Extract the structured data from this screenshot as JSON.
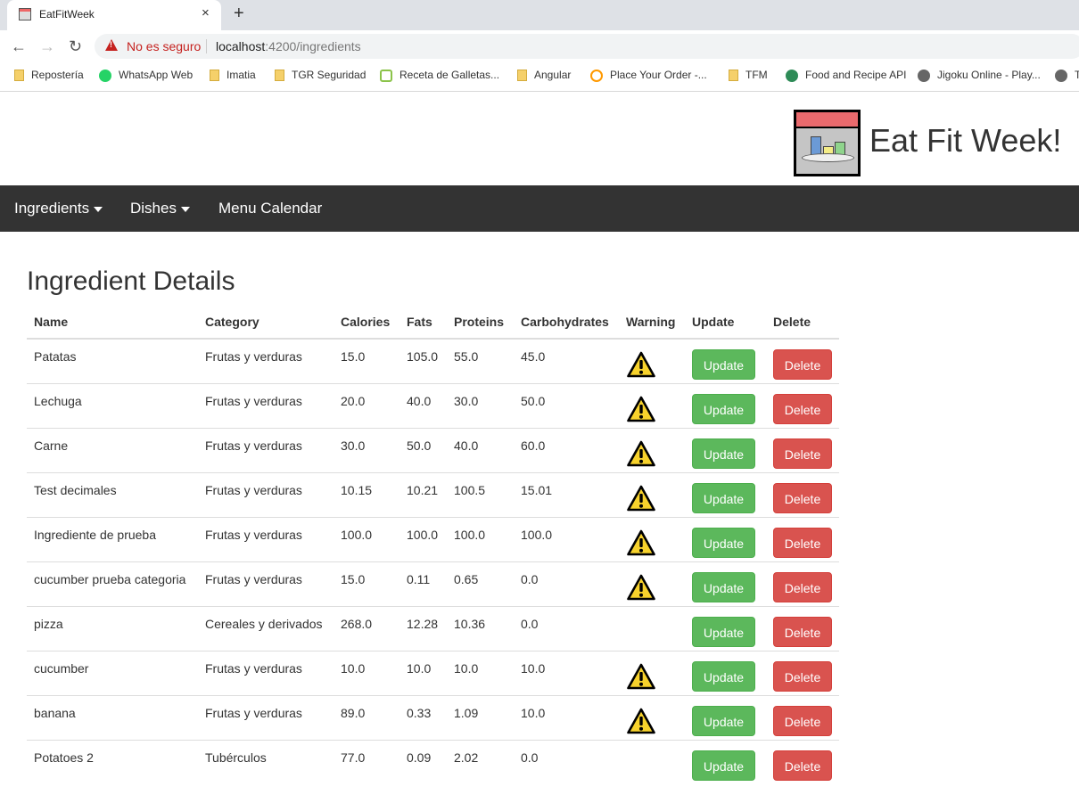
{
  "browser": {
    "tab_title": "EatFitWeek",
    "close_glyph": "×",
    "new_tab_glyph": "+",
    "not_secure": "No es seguro",
    "url_host": "localhost",
    "url_path": ":4200/ingredients",
    "bookmarks": [
      {
        "label": "Repostería",
        "icon": "folder-icon"
      },
      {
        "label": "WhatsApp Web",
        "icon": "whatsapp-icon"
      },
      {
        "label": "Imatia",
        "icon": "folder-icon"
      },
      {
        "label": "TGR Seguridad",
        "icon": "folder-icon"
      },
      {
        "label": "Receta de Galletas...",
        "icon": "tv-icon"
      },
      {
        "label": "Angular",
        "icon": "folder-icon"
      },
      {
        "label": "Place Your Order -...",
        "icon": "amazon-icon"
      },
      {
        "label": "TFM",
        "icon": "folder-icon"
      },
      {
        "label": "Food and Recipe API",
        "icon": "dino-icon"
      },
      {
        "label": "Jigoku Online - Play...",
        "icon": "globe-icon"
      },
      {
        "label": "T",
        "icon": "globe-icon"
      }
    ]
  },
  "header": {
    "brand": "Eat Fit Week!"
  },
  "navbar": {
    "ingredients": "Ingredients",
    "dishes": "Dishes",
    "menu_calendar": "Menu Calendar"
  },
  "page": {
    "title": "Ingredient Details"
  },
  "table": {
    "columns": [
      "Name",
      "Category",
      "Calories",
      "Fats",
      "Proteins",
      "Carbohydrates",
      "Warning",
      "Update",
      "Delete"
    ],
    "update_label": "Update",
    "delete_label": "Delete",
    "rows": [
      {
        "name": "Patatas",
        "category": "Frutas y verduras",
        "calories": "15.0",
        "fats": "105.0",
        "proteins": "55.0",
        "carbohydrates": "45.0",
        "warning": true
      },
      {
        "name": "Lechuga",
        "category": "Frutas y verduras",
        "calories": "20.0",
        "fats": "40.0",
        "proteins": "30.0",
        "carbohydrates": "50.0",
        "warning": true
      },
      {
        "name": "Carne",
        "category": "Frutas y verduras",
        "calories": "30.0",
        "fats": "50.0",
        "proteins": "40.0",
        "carbohydrates": "60.0",
        "warning": true
      },
      {
        "name": "Test decimales",
        "category": "Frutas y verduras",
        "calories": "10.15",
        "fats": "10.21",
        "proteins": "100.5",
        "carbohydrates": "15.01",
        "warning": true
      },
      {
        "name": "Ingrediente de prueba",
        "category": "Frutas y verduras",
        "calories": "100.0",
        "fats": "100.0",
        "proteins": "100.0",
        "carbohydrates": "100.0",
        "warning": true
      },
      {
        "name": "cucumber prueba categoria",
        "category": "Frutas y verduras",
        "calories": "15.0",
        "fats": "0.11",
        "proteins": "0.65",
        "carbohydrates": "0.0",
        "warning": true
      },
      {
        "name": "pizza",
        "category": "Cereales y derivados",
        "calories": "268.0",
        "fats": "12.28",
        "proteins": "10.36",
        "carbohydrates": "0.0",
        "warning": false
      },
      {
        "name": "cucumber",
        "category": "Frutas y verduras",
        "calories": "10.0",
        "fats": "10.0",
        "proteins": "10.0",
        "carbohydrates": "10.0",
        "warning": true
      },
      {
        "name": "banana",
        "category": "Frutas y verduras",
        "calories": "89.0",
        "fats": "0.33",
        "proteins": "1.09",
        "carbohydrates": "10.0",
        "warning": true
      },
      {
        "name": "Potatoes 2",
        "category": "Tubérculos",
        "calories": "77.0",
        "fats": "0.09",
        "proteins": "2.02",
        "carbohydrates": "0.0",
        "warning": false
      }
    ]
  },
  "colors": {
    "navbar_bg": "#333333",
    "update_green": "#5cb85c",
    "delete_red": "#d9534f",
    "warning_yellow": "#f7d22c"
  }
}
